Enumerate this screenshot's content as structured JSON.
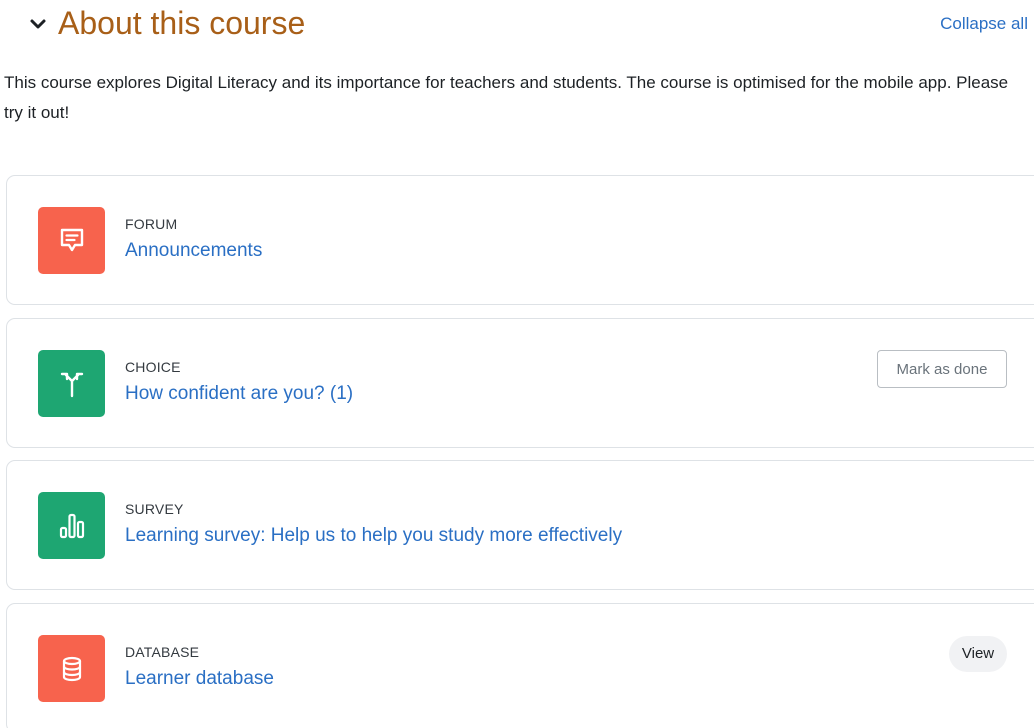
{
  "section": {
    "title": "About this course",
    "collapse_all_label": "Collapse all",
    "summary": "This course explores Digital Literacy and its importance for teachers and students. The course is optimised for the mobile app. Please try it out!",
    "toggle_icon": "chevron-down-icon"
  },
  "activities": [
    {
      "type": "FORUM",
      "name": "Announcements",
      "icon": "forum-icon",
      "icon_color": "#f7634d"
    },
    {
      "type": "CHOICE",
      "name": "How confident are you? (1)",
      "icon": "choice-icon",
      "icon_color": "#1ea672",
      "action_label": "Mark as done"
    },
    {
      "type": "SURVEY",
      "name": "Learning survey: Help us to help you study more effectively",
      "icon": "survey-icon",
      "icon_color": "#1ea672"
    },
    {
      "type": "DATABASE",
      "name": "Learner database",
      "icon": "database-icon",
      "icon_color": "#f7634d",
      "status_label": "View"
    }
  ],
  "colors": {
    "title": "#a85f18",
    "link": "#2a6fc4",
    "border": "#dee2e6"
  }
}
